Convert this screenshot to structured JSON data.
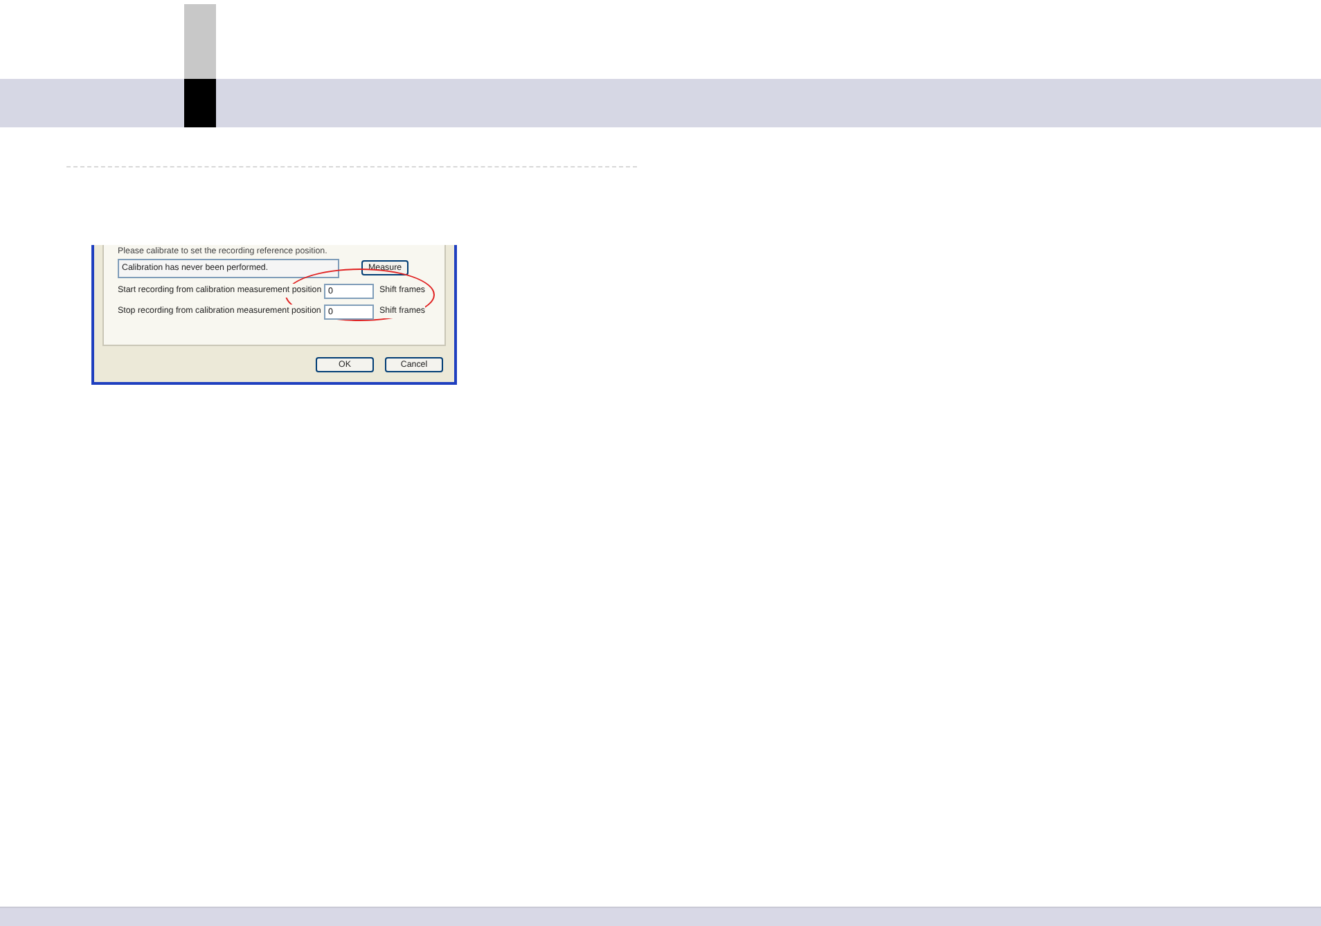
{
  "dialog": {
    "hint": "Please calibrate to set the recording reference position.",
    "status": "Calibration has never been performed.",
    "measure_button": "Measure",
    "fields": [
      {
        "label": "Start recording from calibration measurement position",
        "value": "0",
        "unit": "Shift frames"
      },
      {
        "label": "Stop recording from calibration measurement position",
        "value": "0",
        "unit": "Shift frames"
      }
    ],
    "buttons": [
      "OK",
      "Cancel"
    ]
  }
}
